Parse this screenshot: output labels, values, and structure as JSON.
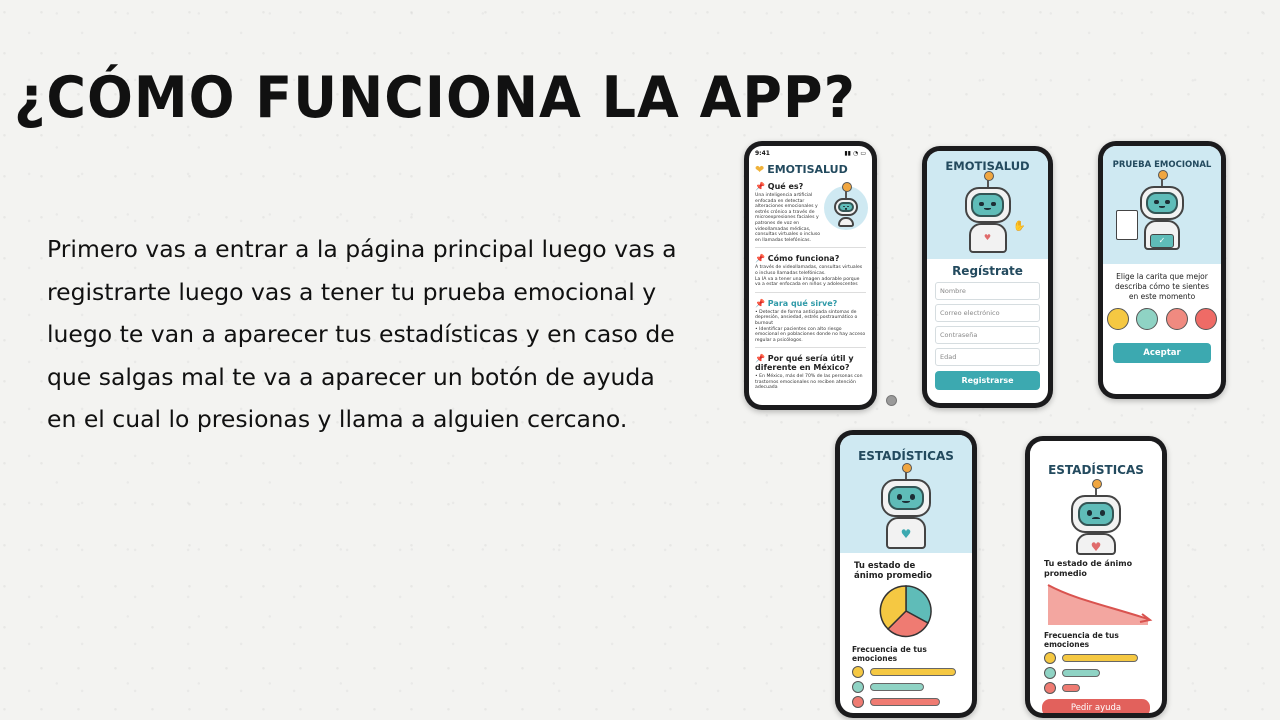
{
  "slide": {
    "title": "¿CÓMO FUNCIONA LA APP?",
    "body": "Primero vas a entrar a la página principal luego vas a registrarte luego vas a tener tu prueba emocional y luego te van a aparecer tus estadísticas y en caso de que salgas mal te va a aparecer un botón de ayuda en el cual lo presionas y llama a alguien cercano."
  },
  "phone1": {
    "time": "9:41",
    "app_name": "EMOTISALUD",
    "sec1_title": "Qué es?",
    "sec1_text": "Una inteligencia artificial enfocada en detectar alteraciones emocionales y estrés crónico a través de microexpresiones faciales y patrones de voz en videollamadas médicas, consultas virtuales o incluso en llamadas telefónicas.",
    "sec2_title": "Cómo funciona?",
    "sec2_text1": "A través de videollamadas, consultas virtuales o incluso llamadas telefónicas.",
    "sec2_text2": "La IA va a tener una imagen adorable porque va a estar enfocada en niños y adolescentes",
    "sec3_title": "Para qué sirve?",
    "sec3_item1": "• Detectar de forma anticipada síntomas de depresión, ansiedad, estrés postraumático o burnout",
    "sec3_item2": "• Identificar pacientes con alto riesgo emocional en poblaciones donde no hay acceso regular a psicólogos.",
    "sec4_title": "Por qué sería útil y diferente en México?",
    "sec4_text": "• En México, más del 70% de las personas con trastornos emocionales no reciben atención adecuada"
  },
  "phone2": {
    "app_name": "EMOTISALUD",
    "heading": "Regístrate",
    "name_ph": "Nombre",
    "email_ph": "Correo electrónico",
    "password_ph": "Contraseña",
    "age_ph": "Edad",
    "button": "Registrarse"
  },
  "phone3": {
    "title": "PRUEBA EMOCIONAL",
    "prompt": "Elige la carita que mejor describa cómo te sientes en este momento",
    "button": "Aceptar"
  },
  "phone4": {
    "title": "ESTADÍSTICAS",
    "mood_label": "Tu estado de ánimo promedio",
    "freq_label": "Frecuencia de tus emociones"
  },
  "phone5": {
    "title": "ESTADÍSTICAS",
    "mood_label": "Tu estado de ánimo promedio",
    "freq_label": "Frecuencia de tus emociones",
    "help_button": "Pedir ayuda"
  },
  "colors": {
    "teal": "#3ca9b0",
    "light_blue": "#cfe9f2",
    "happy": "#f5c842",
    "neutral": "#8fd3c4",
    "sad": "#ef7b72"
  },
  "icons": [
    "heart-icon",
    "pin-icon",
    "robot-icon",
    "emoji-happy-icon",
    "emoji-neutral-icon",
    "emoji-sad-icon",
    "emoji-angry-icon",
    "pie-chart-icon",
    "trend-down-icon"
  ]
}
